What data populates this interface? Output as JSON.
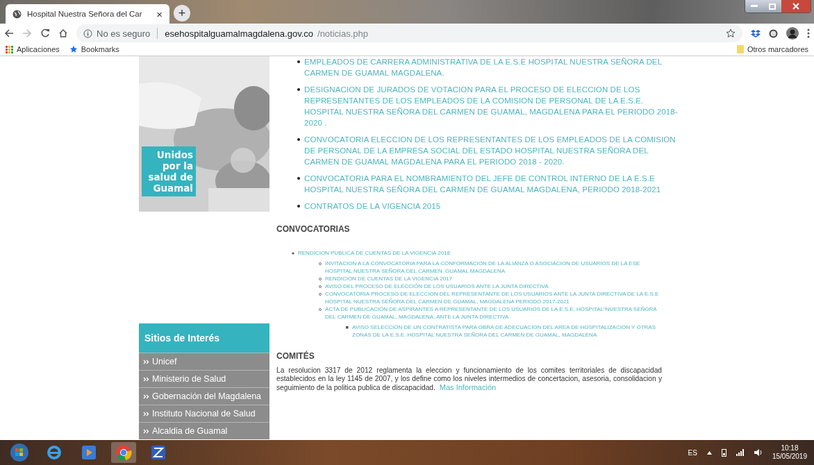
{
  "browser": {
    "tab": {
      "title": "Hospital Nuestra Señora del Car",
      "close": "×"
    },
    "new_tab": "+",
    "security": "No es seguro",
    "url_domain": "esehospitalguamalmagdalena.gov.co",
    "url_path": "/noticias.php",
    "bookmarks": [
      {
        "label": "Aplicaciones",
        "kind": "apps"
      },
      {
        "label": "Bookmarks",
        "kind": "star"
      }
    ],
    "other_bookmarks": "Otros marcadores"
  },
  "sidebar": {
    "banner": [
      "Unidos",
      "por la",
      "salud de",
      "Guamal"
    ],
    "sites_title": "Sitios de Interés",
    "sites": [
      {
        "label": "Unicef"
      },
      {
        "label": "Ministerio de Salud"
      },
      {
        "label": "Gobernación del Magdalena"
      },
      {
        "label": "Instituto Nacional de Salud"
      },
      {
        "label": "Alcaldia de Guamal"
      }
    ]
  },
  "news": [
    "EMPLEADOS DE CARRERA ADMINISTRATIVA DE LA E.S.E HOSPITAL NUESTRA SEÑORA DEL CARMEN DE GUAMAL MAGDALENA.",
    "DESIGNACION DE JURADOS DE VOTACION PARA EL PROCESO DE ELECCION DE LOS REPRESENTANTES DE LOS EMPLEADOS DE LA COMISION DE PERSONAL DE LA E.S.E. HOSPITAL NUESTRA SEÑORA DEL CARMEN DE GUAMAL, MAGDALENA PARA EL PERIODO 2018-2020 .",
    "CONVOCATORIA ELECCION DE LOS REPRESENTANTES DE LOS EMPLEADOS DE LA COMISION DE PERSONAL DE LA EMPRESA SOCIAL DEL ESTADO HOSPITAL NUESTRA SEÑORA DEL CARMEN DE GUAMAL MAGDALENA PARA EL PERIODO 2018 - 2020.",
    "CONVOCATORIA PARA EL NOMBRAMIENTO DEL JEFE DE CONTROL INTERNO DE LA E.S.E HOSPITAL NUESTRA SEÑORA DEL CARMEN DE GUAMAL MAGDALENA, PERIODO 2018-2021",
    "CONTRATOS DE LA VIGENCIA 2015"
  ],
  "convocatorias": {
    "heading": "CONVOCATORIAS",
    "items": [
      {
        "text": "RENDICION PUBLICA DE CUENTAS DE LA VIGENCIA 2018",
        "children": [
          {
            "text": "INVITACION A LA CONVOCATORIA PARA LA CONFORMACION DE LA ALIANZA O ASOCIACION DE USUARIOS DE LA ESE HOSPITAL NUESTRA SEÑORA DEL CARMEN. GUAMAL MAGDALENA"
          },
          {
            "text": "RENDICION DE CUENTAS DE LA VIGENCIA 2017"
          },
          {
            "text": "AVISO DEL PROCESO DE ELECCIÓN DE LOS USUARIOS ANTE LA JUNTA DIRECTIVA"
          },
          {
            "text": "CONVOCATORIA PROCESO DE ELECCION DEL REPRESENTANTE DE LOS USUARIOS ANTE LA JUNTA DIRECTIVA DE LA E.S.E HOSPITAL NUESTRA SEÑORA DEL CARMEN DE GUAMAL, MAGDALENA PERIODO 2017-2021"
          },
          {
            "text": "ACTA DE PUBLICACIÓN DE ASPIRANTES A REPRESENTANTE DE LOS USUARIOS DE LA E.S.E. HOSPITAL\"NUESTRA SEÑORA DEL CARMEN DE GUAMAL, MAGDALENA, ANTE LA JUNTA DIRECTIVA",
            "children": [
              {
                "text": "AVISO SELECCION DE UN CONTRATISTA PARA OBRA DE ADECUACION DEL AREA DE HOSPITALIZACION Y OTRAS ZONAS DE LA E.S.E. HOSPITAL NUESTRA SEÑORA DEL CARMEN DE GUAMAL, MAGDALENA"
              }
            ]
          }
        ]
      }
    ]
  },
  "comites": {
    "heading": "COMITÉS",
    "text": "La resolucion 3317 de 2012 reglamenta la eleccion y funcionamiento de los comites territoriales de discapacidad establecidos en la ley 1145 de 2007, y los define como los niveles intermedios de concertacion, asesoria, consolidacion y seguimiento de la politica publica de discapacidad.",
    "link": "Mas Información"
  },
  "taskbar": {
    "language": "ES",
    "time": "10:18",
    "date": "15/05/2019"
  }
}
